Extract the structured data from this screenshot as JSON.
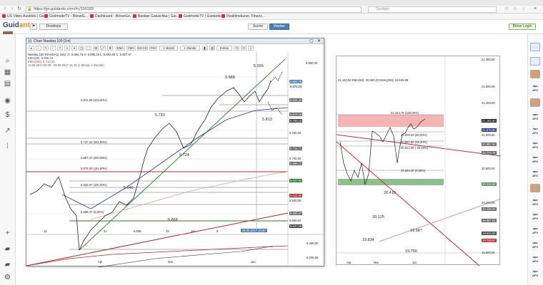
{
  "browser": {
    "url": "https://go.guidants.com/#c/150183",
    "search_placeholder": "Suchen",
    "bookmarks": [
      "US Video Ausblick | Gu...",
      "GodmodeTV - BörseG...",
      "Dashboard - BörseGo...",
      "Bastian Galuschka | Gui...",
      "GodmodeTV | Guidants",
      "Realtimekurse, Finanz..."
    ]
  },
  "app": {
    "logo_main": "Guid",
    "logo_accent": "ants",
    "desktop_label": "Desktops",
    "suche_label": "Suche",
    "worker_label": "Worker",
    "login_label": "Börse Login"
  },
  "chart1": {
    "title": "Chart Nasdaq 100 [1m]",
    "toolbar": [
      "EMA",
      "SMA",
      "MACD",
      "RSI",
      "1 Monat",
      "1 Stunde",
      "Extras"
    ],
    "legend_line1": "Nasdaq 100 (NASDAQ, last): O: 5.894,75  H: 5.895,16  L: 5.852,60  C: 5.857,97",
    "legend_line2": "EMA(50): 5.838,16",
    "legend_line3": "EMA(200): 5.713,31",
    "legend_line4": "11.05.2017 20:30 - 08.06.2017 21:30 (1 Monat, 1 Stunde)",
    "price_labels": [
      "5.950,00",
      "5.894,75",
      "5.874,23",
      "5.846,32",
      "5.813,26",
      "5.793,13",
      "5.750,00",
      "5.724,71",
      "5.700,00",
      "5.688,74",
      "5.647,83",
      "5.610,50",
      "5.600,00",
      "5.568,47",
      "5.550,00",
      "5.537,06"
    ],
    "chart_annotations": [
      "5.888",
      "5.926",
      "5.793",
      "5.813",
      "5.724",
      "5.646",
      "5.868",
      "5.838"
    ],
    "fib_labels": [
      "5.841,69 (423,60%)",
      "5.737,33 (261,80%)",
      "5.697,47 (200,00%)",
      "5.672,83 (161,80%)",
      "5.632,97 (100,00%)",
      "5.568,47 (0,00%)"
    ],
    "date_labels": [
      "15",
      "22",
      "29",
      "Jun",
      "5"
    ],
    "crosshair_date": "08.06.2017 15:30",
    "sub_labels": [
      "5.300,00",
      "5.200,00"
    ],
    "sub_dates": [
      "Apr",
      "Mai",
      "Jun"
    ],
    "extra_label": "5.838"
  },
  "chart2": {
    "header": "21.182,50  EMA(50): 20.883,03  EMA(200): 19.629,59",
    "price_labels": [
      "21.350,00",
      "21.600,00",
      "21.400,00",
      "21.182,50",
      "21.070,90",
      "21.000,00",
      "20.887,50",
      "20.774,76",
      "20.600,00",
      "20.412,50",
      "20.200,00",
      "20.125,00",
      "19.987,63",
      "19.834,08",
      "19.748,67",
      "19.600,00"
    ],
    "annotations": [
      "20.410",
      "20.125",
      "19.987",
      "19.834",
      "19.750",
      "21.244,75 (100,00%)",
      "21.000,00 (50,00%)",
      "20.887,50 (38,20%)",
      "20.617,50 (-23,60%)",
      "20.553,40 (0,00%)"
    ],
    "date_labels": [
      "Apr",
      "Mai",
      "Jun"
    ]
  },
  "colors": {
    "accent": "#4d7fb3",
    "ema50": "#2b3a8c",
    "ema200": "#b33",
    "trend_green": "#2e8b2e",
    "resistance_red": "#b52525",
    "zone_red": "#f4b4b4",
    "zone_green": "#8fbf8f"
  }
}
